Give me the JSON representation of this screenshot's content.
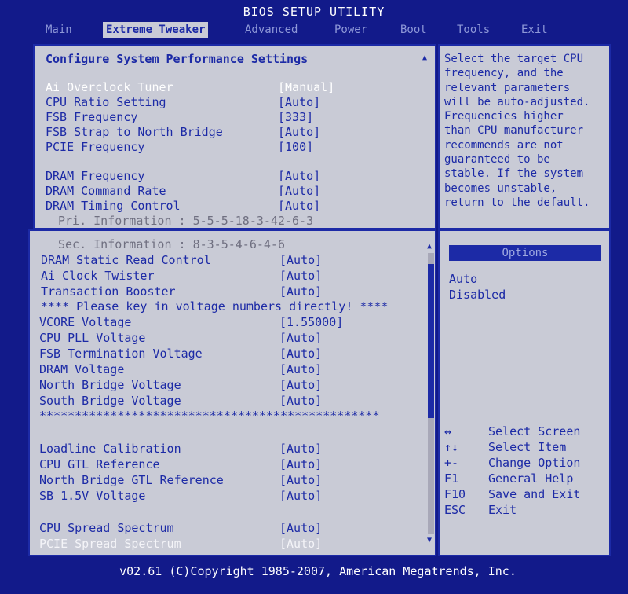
{
  "title": "BIOS SETUP UTILITY",
  "tabs": [
    "Main",
    "Extreme Tweaker",
    "Advanced",
    "Power",
    "Boot",
    "Tools",
    "Exit"
  ],
  "top_panel": {
    "heading": "Configure System Performance Settings",
    "items": [
      {
        "label": "Ai Overclock Tuner",
        "value": "[Manual]"
      },
      {
        "label": "CPU Ratio Setting",
        "value": "[Auto]"
      },
      {
        "label": "FSB Frequency",
        "value": "[333]"
      },
      {
        "label": "FSB Strap to North Bridge",
        "value": "[Auto]"
      },
      {
        "label": "PCIE Frequency",
        "value": "[100]"
      },
      {
        "label": "DRAM Frequency",
        "value": "[Auto]"
      },
      {
        "label": "DRAM Command Rate",
        "value": "[Auto]"
      },
      {
        "label": "DRAM Timing Control",
        "value": "[Auto]"
      }
    ],
    "pri_info": "Pri. Information : 5-5-5-18-3-42-6-3"
  },
  "help_text": "Select the target CPU\nfrequency, and the\nrelevant parameters\nwill be auto-adjusted.\nFrequencies higher\nthan CPU manufacturer\nrecommends are not\nguaranteed to be\nstable. If the system\nbecomes unstable,\nreturn to the default.",
  "bottom_panel": {
    "sec_info": "Sec. Information : 8-3-5-4-6-4-6",
    "items_a": [
      {
        "label": "DRAM Static Read Control",
        "value": "[Auto]"
      },
      {
        "label": "Ai Clock Twister",
        "value": "[Auto]"
      },
      {
        "label": "Transaction Booster",
        "value": "[Auto]"
      }
    ],
    "voltage_note": "**** Please key in voltage numbers directly! ****",
    "items_b": [
      {
        "label": "VCORE Voltage",
        "value": "[1.55000]"
      },
      {
        "label": "CPU PLL Voltage",
        "value": "[Auto]"
      },
      {
        "label": "FSB Termination Voltage",
        "value": "[Auto]"
      },
      {
        "label": "DRAM Voltage",
        "value": "[Auto]"
      },
      {
        "label": "North Bridge Voltage",
        "value": "[Auto]"
      },
      {
        "label": "South Bridge Voltage",
        "value": "[Auto]"
      }
    ],
    "separator": "************************************************",
    "items_c": [
      {
        "label": "Loadline Calibration",
        "value": "[Auto]"
      },
      {
        "label": "CPU GTL Reference",
        "value": "[Auto]"
      },
      {
        "label": "North Bridge GTL Reference",
        "value": "[Auto]"
      },
      {
        "label": "SB 1.5V Voltage",
        "value": "[Auto]"
      }
    ],
    "items_d": [
      {
        "label": "CPU Spread Spectrum",
        "value": "[Auto]"
      },
      {
        "label": "PCIE Spread Spectrum",
        "value": "[Auto]"
      }
    ]
  },
  "options": {
    "title": "Options",
    "items": [
      "Auto",
      "Disabled"
    ]
  },
  "keys": [
    {
      "key": "↔",
      "desc": "Select Screen"
    },
    {
      "key": "↑↓",
      "desc": "Select Item"
    },
    {
      "key": "+-",
      "desc": "Change Option"
    },
    {
      "key": "F1",
      "desc": "General Help"
    },
    {
      "key": "F10",
      "desc": "Save and Exit"
    },
    {
      "key": "ESC",
      "desc": "Exit"
    }
  ],
  "footer": "v02.61 (C)Copyright 1985-2007, American Megatrends, Inc.",
  "colors": {
    "blue": "#1c2aa6",
    "panel": "#c9cbd6",
    "background": "#121a8a"
  }
}
